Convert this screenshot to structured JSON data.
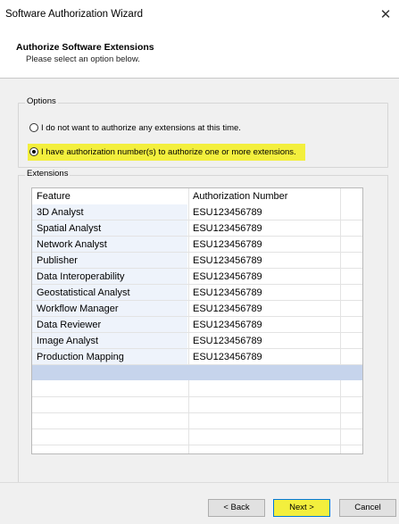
{
  "window": {
    "title": "Software Authorization Wizard",
    "close_glyph": "✕"
  },
  "header": {
    "title": "Authorize Software Extensions",
    "subtitle": "Please select an option below."
  },
  "options": {
    "legend": "Options",
    "radio_none": {
      "label": "I do not want to authorize any extensions at this time.",
      "checked": false
    },
    "radio_have": {
      "label": "I have authorization number(s) to authorize one or more extensions.",
      "checked": true
    }
  },
  "extensions": {
    "legend": "Extensions",
    "columns": [
      "Feature",
      "Authorization Number"
    ],
    "rows": [
      {
        "feature": "3D Analyst",
        "auth": "ESU123456789"
      },
      {
        "feature": "Spatial Analyst",
        "auth": "ESU123456789"
      },
      {
        "feature": "Network Analyst",
        "auth": "ESU123456789"
      },
      {
        "feature": "Publisher",
        "auth": "ESU123456789"
      },
      {
        "feature": "Data Interoperability",
        "auth": "ESU123456789"
      },
      {
        "feature": "Geostatistical Analyst",
        "auth": "ESU123456789"
      },
      {
        "feature": "Workflow Manager",
        "auth": "ESU123456789"
      },
      {
        "feature": "Data Reviewer",
        "auth": "ESU123456789"
      },
      {
        "feature": "Image Analyst",
        "auth": "ESU123456789"
      },
      {
        "feature": "Production Mapping",
        "auth": "ESU123456789"
      }
    ]
  },
  "footer": {
    "back_label": "< Back",
    "next_label": "Next >",
    "cancel_label": "Cancel"
  },
  "colors": {
    "highlight": "#f3ef3d",
    "selected_row": "#c6d4ec"
  }
}
